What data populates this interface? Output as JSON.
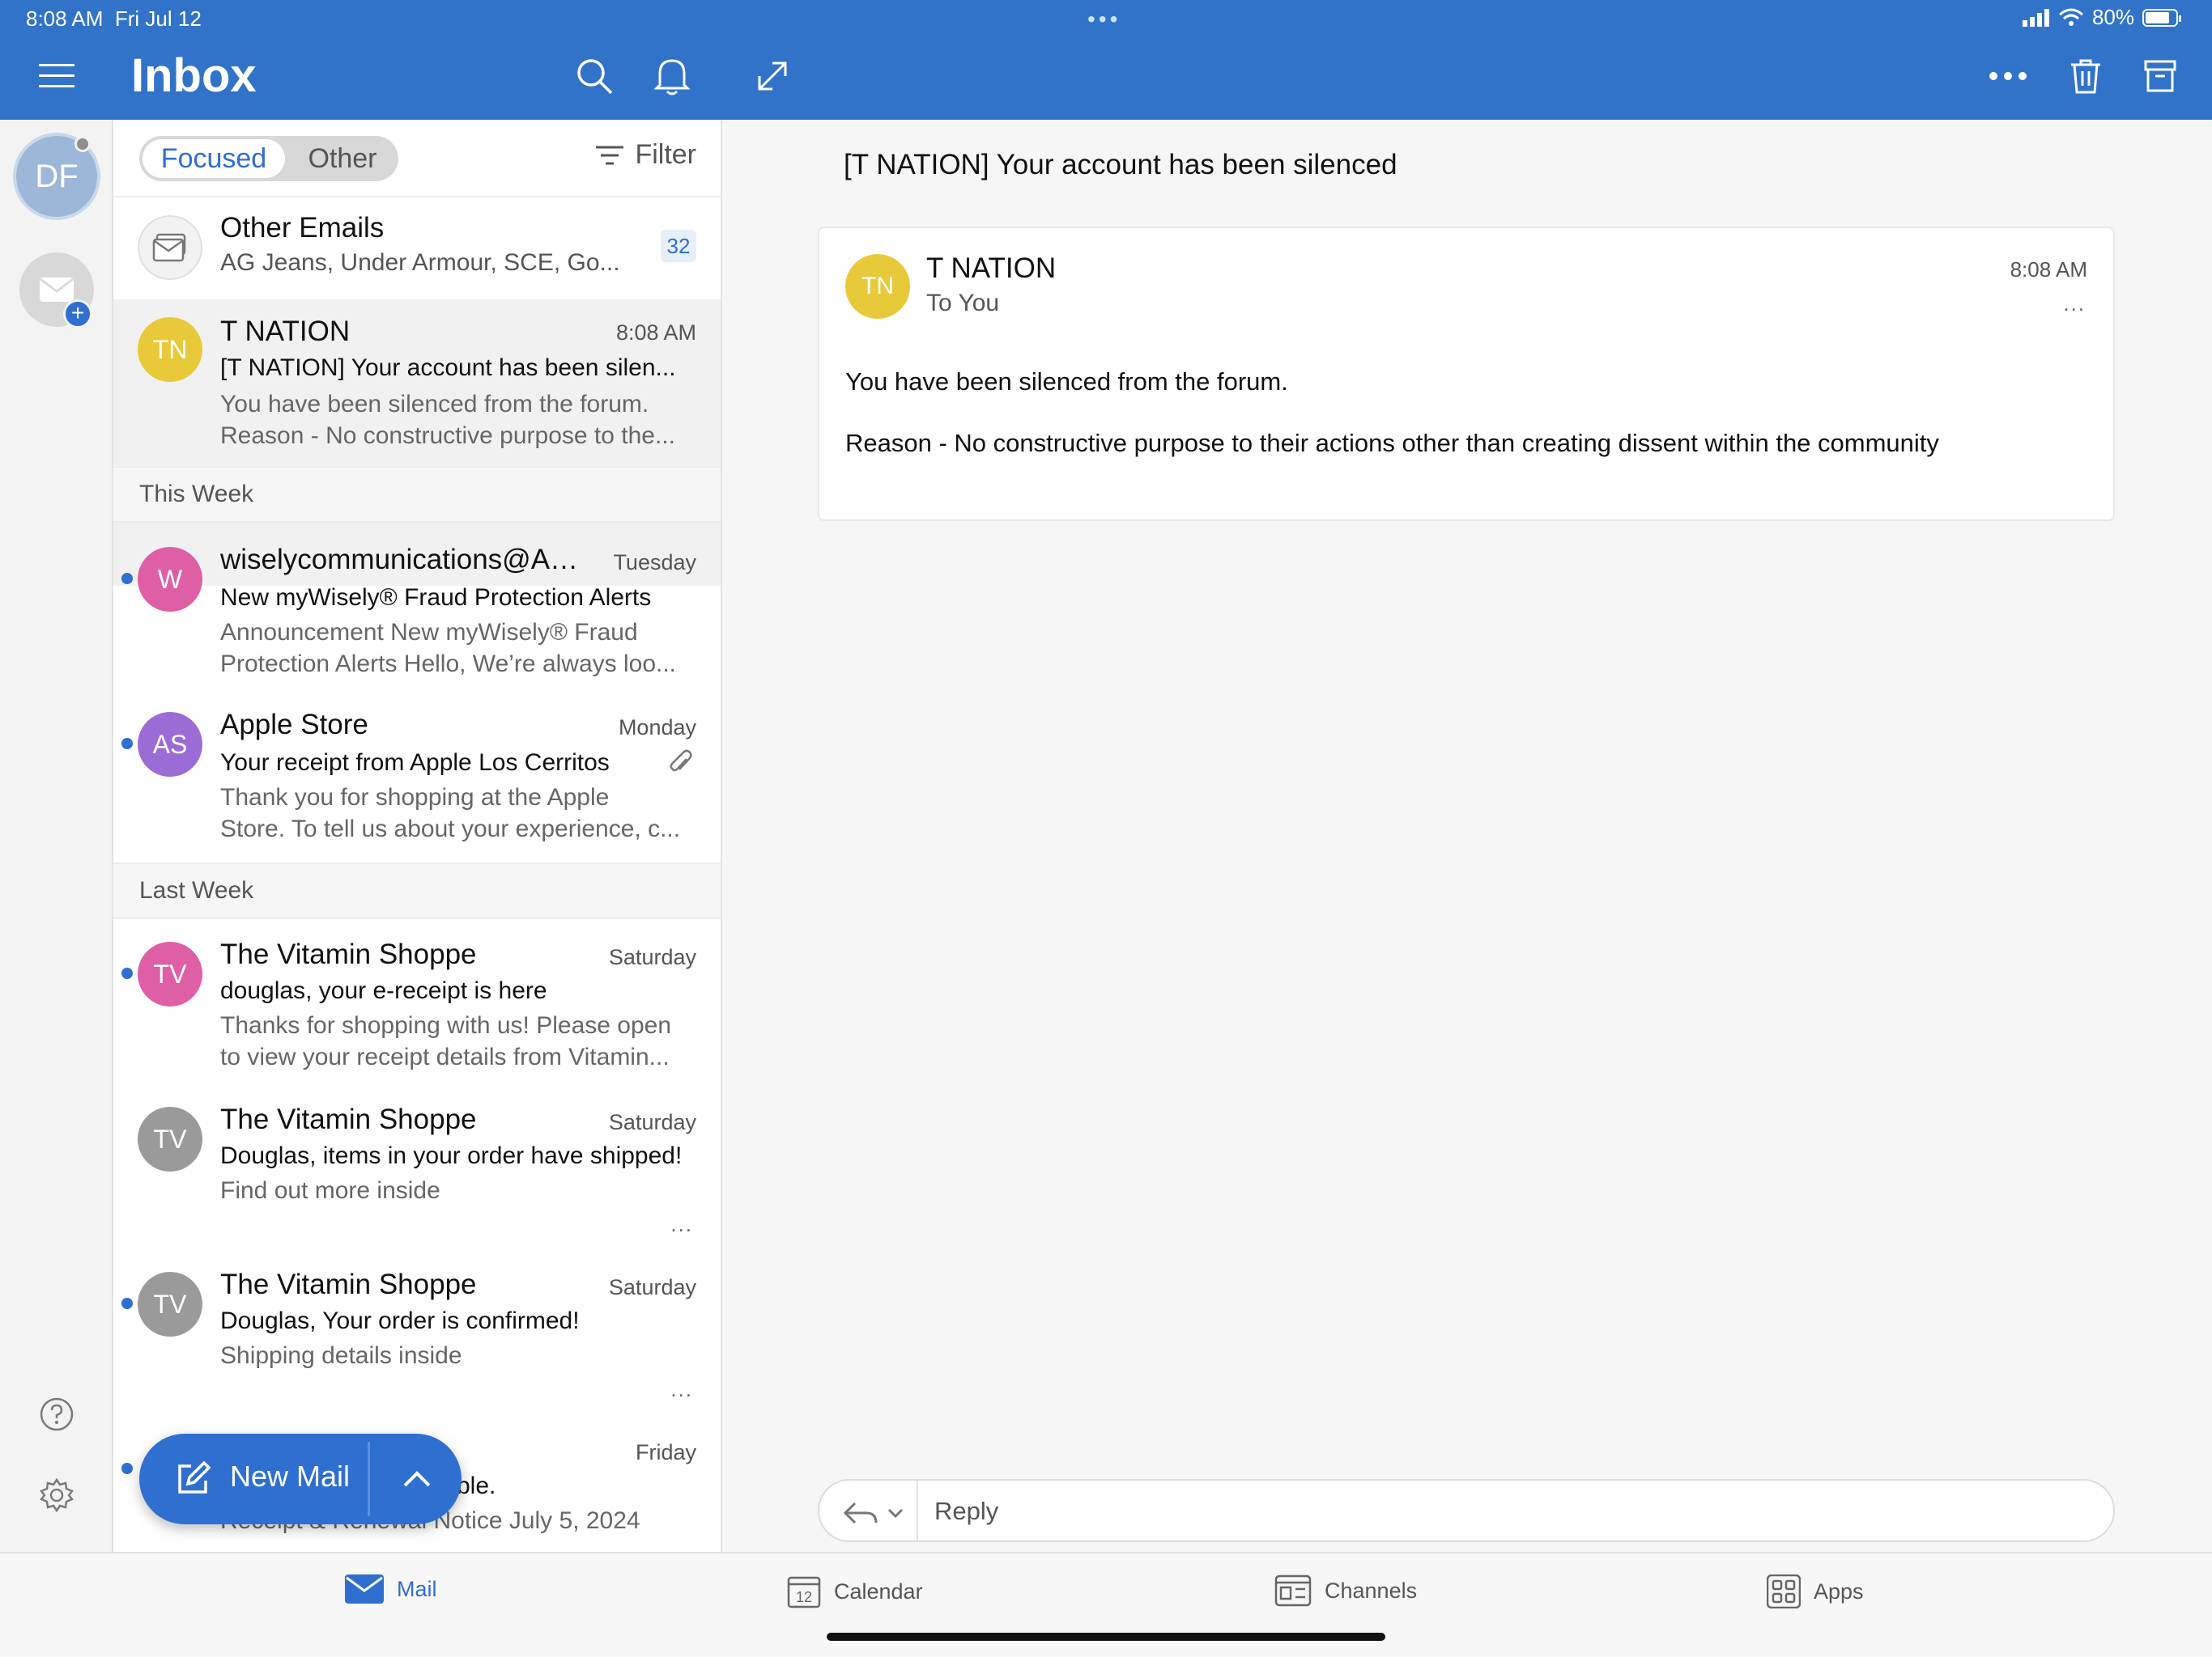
{
  "status": {
    "time": "8:08 AM",
    "date": "Fri Jul 12",
    "battery": "80%",
    "dots": "•••"
  },
  "header": {
    "title": "Inbox"
  },
  "rail": {
    "avatar_initials": "DF"
  },
  "tabs": {
    "focused": "Focused",
    "other": "Other",
    "filter": "Filter"
  },
  "other_emails": {
    "title": "Other Emails",
    "preview": "AG Jeans, Under Armour, SCE, Go...",
    "count": "32"
  },
  "messages_top": [
    {
      "initials": "TN",
      "sender": "T NATION",
      "date": "8:08 AM",
      "subject": "[T NATION] Your account has been silen...",
      "preview1": "You have been silenced from the forum.",
      "preview2": "Reason - No constructive purpose to the...",
      "color": "#e8c93a"
    }
  ],
  "sections": {
    "this_week": "This Week",
    "last_week": "Last Week"
  },
  "messages_week": [
    {
      "initials": "W",
      "sender": "wiselycommunications@AD...",
      "date": "Tuesday",
      "subject": "New myWisely® Fraud Protection Alerts",
      "preview1": "Announcement New myWisely® Fraud",
      "preview2": "Protection Alerts Hello, We’re always loo...",
      "color": "#df5fa6"
    },
    {
      "initials": "AS",
      "sender": "Apple Store",
      "date": "Monday",
      "subject": "Your receipt from Apple Los Cerritos",
      "preview1": "Thank you for shopping at the Apple",
      "preview2": "Store. To tell us about your experience, c...",
      "color": "#9b6bd6"
    }
  ],
  "messages_last": [
    {
      "initials": "TV",
      "sender": "The Vitamin Shoppe",
      "date": "Saturday",
      "subject": "douglas, your e-receipt is here",
      "preview1": "Thanks for shopping with us! Please open",
      "preview2": "to view your receipt details from Vitamin...",
      "color": "#df5fa6"
    },
    {
      "initials": "TV",
      "sender": "The Vitamin Shoppe",
      "date": "Saturday",
      "subject": "Douglas, items in your order have shipped!",
      "preview1": "Find out more inside",
      "color": "#9a9a9a"
    },
    {
      "initials": "TV",
      "sender": "The Vitamin Shoppe",
      "date": "Saturday",
      "subject": "Douglas, Your order is confirmed!",
      "preview1": "Shipping details inside",
      "color": "#9a9a9a"
    }
  ],
  "partial_row": {
    "date": "Friday",
    "subject_tail": "ble.",
    "preview1": "Receipt & Renewal Notice July 5, 2024"
  },
  "more": "...",
  "fab": {
    "label": "New Mail"
  },
  "reading": {
    "title": "[T NATION] Your account has been silenced",
    "initials": "TN",
    "from": "T NATION",
    "to": "To You",
    "time": "8:08 AM",
    "body1": "You have been silenced from the forum.",
    "body2": "Reason - No constructive purpose to their actions other than creating dissent within the community",
    "reply": "Reply"
  },
  "tabbar": {
    "mail": "Mail",
    "calendar": "Calendar",
    "calendar_day": "12",
    "channels": "Channels",
    "apps": "Apps"
  },
  "colors": {
    "accent": "#3173c8",
    "unread": "#2f6fd0"
  }
}
